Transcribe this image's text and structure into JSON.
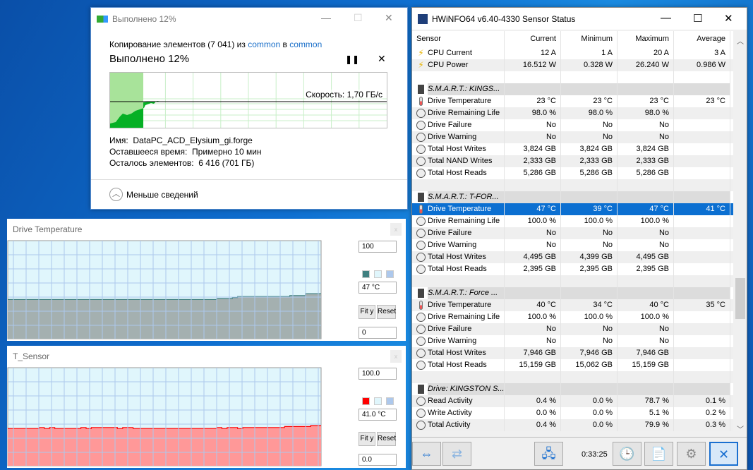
{
  "copy_dialog": {
    "title": "Выполнено 12%",
    "desc_prefix": "Копирование элементов (7 041) из ",
    "src": "common",
    "desc_mid": " в ",
    "dst": "common",
    "progress_label": "Выполнено 12%",
    "progress_percent": 12,
    "speed": "Скорость: 1,70 ГБ/с",
    "name_label": "Имя:",
    "name_value": "DataPC_ACD_Elysium_gi.forge",
    "time_label": "Оставшееся время:",
    "time_value": "Примерно 10 мин",
    "items_label": "Осталось элементов:",
    "items_value": "6 416 (701 ГБ)",
    "less_details": "Меньше сведений",
    "colors": {
      "fill": "#06b025",
      "bg_fill": "#a8e39a"
    }
  },
  "graphs": [
    {
      "title": "Drive Temperature",
      "max": "100",
      "current": "47 °C",
      "min": "0",
      "fit": "Fit y",
      "reset": "Reset",
      "colors": {
        "line": "#3f7f7f",
        "fill": "#a4b0b0",
        "bg": "#e0f6fc"
      },
      "values": [
        40,
        40,
        40,
        40,
        40,
        40,
        40,
        40,
        40,
        40,
        40,
        40,
        40,
        40,
        40,
        40,
        40,
        40,
        40,
        40,
        40,
        40,
        40,
        40,
        40,
        40,
        40,
        40,
        40,
        40,
        40,
        40,
        40,
        40,
        40,
        40,
        40,
        40,
        40,
        40,
        41,
        41,
        41,
        42,
        43,
        43,
        43,
        43,
        43,
        43,
        43,
        43,
        43,
        43,
        44,
        44,
        44,
        46,
        46,
        46
      ]
    },
    {
      "title": "T_Sensor",
      "max": "100.0",
      "current": "41.0 °C",
      "min": "0.0",
      "fit": "Fit y",
      "reset": "Reset",
      "colors": {
        "line": "#ff0000",
        "fill": "#ff9898",
        "bg": "#e0f6fc"
      },
      "values": [
        38,
        38,
        38,
        38,
        38,
        38,
        39,
        38,
        39,
        38,
        38,
        38,
        38,
        38,
        39,
        38,
        39,
        39,
        39,
        39,
        39,
        38,
        39,
        39,
        38,
        38,
        38,
        38,
        38,
        38,
        38,
        38,
        38,
        38,
        38,
        38,
        38,
        38,
        38,
        38,
        39,
        38,
        39,
        39,
        38,
        39,
        39,
        39,
        39,
        39,
        39,
        39,
        39,
        40,
        40,
        40,
        40,
        40,
        41,
        41
      ]
    }
  ],
  "hwinfo": {
    "title": "HWiNFO64 v6.40-4330 Sensor Status",
    "columns": [
      "Sensor",
      "Current",
      "Minimum",
      "Maximum",
      "Average"
    ],
    "rows": [
      {
        "type": "item",
        "icon": "bolt",
        "label": "CPU Current",
        "v": [
          "12 A",
          "1 A",
          "20 A",
          "3 A"
        ]
      },
      {
        "type": "item",
        "icon": "bolt",
        "label": "CPU Power",
        "v": [
          "16.512 W",
          "0.328 W",
          "26.240 W",
          "0.986 W"
        ]
      },
      {
        "type": "blank"
      },
      {
        "type": "group",
        "label": "S.M.A.R.T.: KINGS..."
      },
      {
        "type": "item",
        "icon": "therm",
        "label": "Drive Temperature",
        "v": [
          "23 °C",
          "23 °C",
          "23 °C",
          "23 °C"
        ]
      },
      {
        "type": "item",
        "icon": "gauge",
        "label": "Drive Remaining Life",
        "v": [
          "98.0 %",
          "98.0 %",
          "98.0 %",
          ""
        ]
      },
      {
        "type": "item",
        "icon": "gauge",
        "label": "Drive Failure",
        "v": [
          "No",
          "No",
          "No",
          ""
        ]
      },
      {
        "type": "item",
        "icon": "gauge",
        "label": "Drive Warning",
        "v": [
          "No",
          "No",
          "No",
          ""
        ]
      },
      {
        "type": "item",
        "icon": "gauge",
        "label": "Total Host Writes",
        "v": [
          "3,824 GB",
          "3,824 GB",
          "3,824 GB",
          ""
        ]
      },
      {
        "type": "item",
        "icon": "gauge",
        "label": "Total NAND Writes",
        "v": [
          "2,333 GB",
          "2,333 GB",
          "2,333 GB",
          ""
        ]
      },
      {
        "type": "item",
        "icon": "gauge",
        "label": "Total Host Reads",
        "v": [
          "5,286 GB",
          "5,286 GB",
          "5,286 GB",
          ""
        ]
      },
      {
        "type": "blank"
      },
      {
        "type": "group",
        "label": "S.M.A.R.T.: T-FOR..."
      },
      {
        "type": "item",
        "icon": "therm",
        "label": "Drive Temperature",
        "v": [
          "47 °C",
          "39 °C",
          "47 °C",
          "41 °C"
        ],
        "selected": true
      },
      {
        "type": "item",
        "icon": "gauge",
        "label": "Drive Remaining Life",
        "v": [
          "100.0 %",
          "100.0 %",
          "100.0 %",
          ""
        ]
      },
      {
        "type": "item",
        "icon": "gauge",
        "label": "Drive Failure",
        "v": [
          "No",
          "No",
          "No",
          ""
        ]
      },
      {
        "type": "item",
        "icon": "gauge",
        "label": "Drive Warning",
        "v": [
          "No",
          "No",
          "No",
          ""
        ]
      },
      {
        "type": "item",
        "icon": "gauge",
        "label": "Total Host Writes",
        "v": [
          "4,495 GB",
          "4,399 GB",
          "4,495 GB",
          ""
        ]
      },
      {
        "type": "item",
        "icon": "gauge",
        "label": "Total Host Reads",
        "v": [
          "2,395 GB",
          "2,395 GB",
          "2,395 GB",
          ""
        ]
      },
      {
        "type": "blank"
      },
      {
        "type": "group",
        "label": "S.M.A.R.T.: Force ..."
      },
      {
        "type": "item",
        "icon": "therm",
        "label": "Drive Temperature",
        "v": [
          "40 °C",
          "34 °C",
          "40 °C",
          "35 °C"
        ]
      },
      {
        "type": "item",
        "icon": "gauge",
        "label": "Drive Remaining Life",
        "v": [
          "100.0 %",
          "100.0 %",
          "100.0 %",
          ""
        ]
      },
      {
        "type": "item",
        "icon": "gauge",
        "label": "Drive Failure",
        "v": [
          "No",
          "No",
          "No",
          ""
        ]
      },
      {
        "type": "item",
        "icon": "gauge",
        "label": "Drive Warning",
        "v": [
          "No",
          "No",
          "No",
          ""
        ]
      },
      {
        "type": "item",
        "icon": "gauge",
        "label": "Total Host Writes",
        "v": [
          "7,946 GB",
          "7,946 GB",
          "7,946 GB",
          ""
        ]
      },
      {
        "type": "item",
        "icon": "gauge",
        "label": "Total Host Reads",
        "v": [
          "15,159 GB",
          "15,062 GB",
          "15,159 GB",
          ""
        ]
      },
      {
        "type": "blank"
      },
      {
        "type": "group",
        "label": "Drive: KINGSTON S..."
      },
      {
        "type": "item",
        "icon": "gauge",
        "label": "Read Activity",
        "v": [
          "0.4 %",
          "0.0 %",
          "78.7 %",
          "0.1 %"
        ]
      },
      {
        "type": "item",
        "icon": "gauge",
        "label": "Write Activity",
        "v": [
          "0.0 %",
          "0.0 %",
          "5.1 %",
          "0.2 %"
        ]
      },
      {
        "type": "item",
        "icon": "gauge",
        "label": "Total Activity",
        "v": [
          "0.4 %",
          "0.0 %",
          "79.9 %",
          "0.3 %"
        ]
      }
    ],
    "timer": "0:33:25",
    "colors": {
      "selected": "#0b6fd1"
    }
  }
}
